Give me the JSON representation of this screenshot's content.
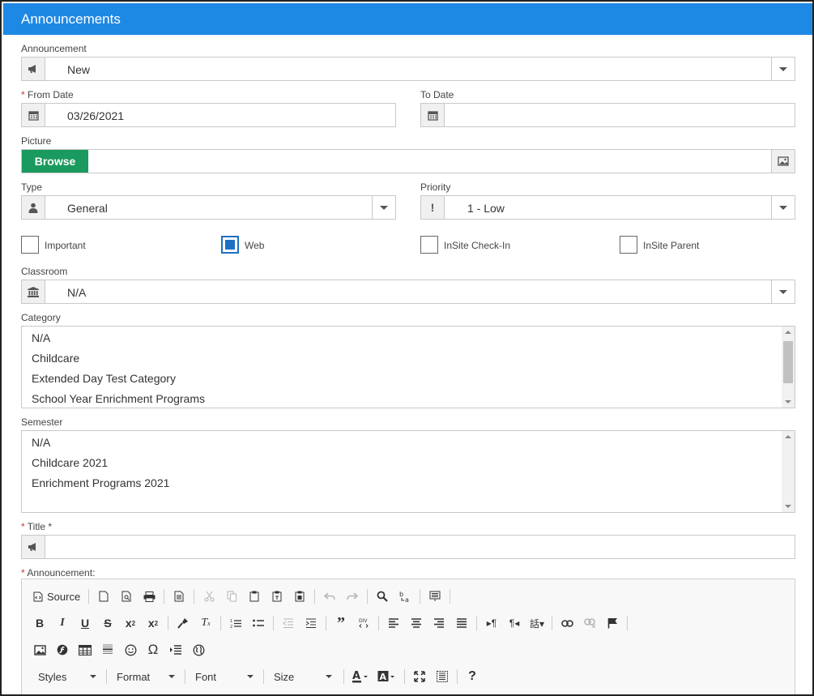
{
  "header": {
    "title": "Announcements"
  },
  "announcement_select": {
    "label": "Announcement",
    "value": "New"
  },
  "from_date": {
    "required": "*",
    "label": "From Date",
    "value": "03/26/2021"
  },
  "to_date": {
    "label": "To Date",
    "value": ""
  },
  "picture": {
    "label": "Picture",
    "browse_label": "Browse"
  },
  "type_select": {
    "label": "Type",
    "value": "General"
  },
  "priority_select": {
    "label": "Priority",
    "icon_text": "!",
    "value": "1 - Low"
  },
  "checkboxes": [
    {
      "label": "Important",
      "checked": false
    },
    {
      "label": "Web",
      "checked": true
    },
    {
      "label": "InSite Check-In",
      "checked": false
    },
    {
      "label": "InSite Parent",
      "checked": false
    }
  ],
  "classroom_select": {
    "label": "Classroom",
    "value": "N/A"
  },
  "category": {
    "label": "Category",
    "items": [
      "N/A",
      "Childcare",
      "Extended Day Test Category",
      "School Year Enrichment Programs"
    ]
  },
  "semester": {
    "label": "Semester",
    "items": [
      "N/A",
      "Childcare 2021",
      "Enrichment Programs 2021"
    ]
  },
  "title_field": {
    "required": "*",
    "label": "Title *",
    "value": ""
  },
  "announcement_editor": {
    "required": "*",
    "label": "Announcement:",
    "source_label": "Source",
    "combos": [
      "Styles",
      "Format",
      "Font",
      "Size"
    ]
  },
  "colors": {
    "header_bg": "#1e88e5",
    "browse_bg": "#1a9a5e",
    "checkbox_checked": "#1e6fc4",
    "required_star": "#d32f2f"
  }
}
